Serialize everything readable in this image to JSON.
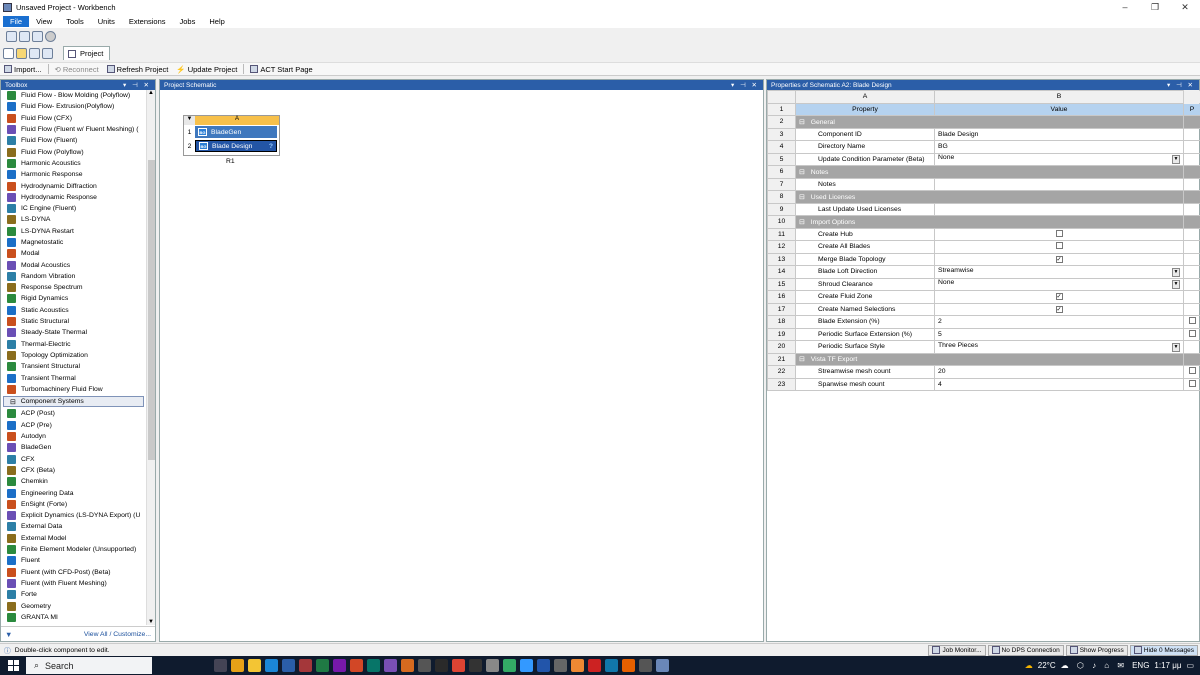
{
  "window": {
    "title": "Unsaved Project - Workbench"
  },
  "menus": [
    "File",
    "View",
    "Tools",
    "Units",
    "Extensions",
    "Jobs",
    "Help"
  ],
  "tab": {
    "label": "Project"
  },
  "commands": {
    "import": "Import...",
    "reconnect": "Reconnect",
    "refresh": "Refresh Project",
    "update": "Update Project",
    "act": "ACT Start Page"
  },
  "toolbox": {
    "title": "Toolbox",
    "analysis_items": [
      "Fluid Flow - Blow Molding (Polyflow)",
      "Fluid Flow- Extrusion(Polyflow)",
      "Fluid Flow (CFX)",
      "Fluid Flow (Fluent w/ Fluent Meshing) (",
      "Fluid Flow (Fluent)",
      "Fluid Flow (Polyflow)",
      "Harmonic Acoustics",
      "Harmonic Response",
      "Hydrodynamic Diffraction",
      "Hydrodynamic Response",
      "IC Engine (Fluent)",
      "LS-DYNA",
      "LS-DYNA Restart",
      "Magnetostatic",
      "Modal",
      "Modal Acoustics",
      "Random Vibration",
      "Response Spectrum",
      "Rigid Dynamics",
      "Static Acoustics",
      "Static Structural",
      "Steady-State Thermal",
      "Thermal-Electric",
      "Topology Optimization",
      "Transient Structural",
      "Transient Thermal",
      "Turbomachinery Fluid Flow"
    ],
    "group_label": "Component Systems",
    "component_items": [
      "ACP (Post)",
      "ACP (Pre)",
      "Autodyn",
      "BladeGen",
      "CFX",
      "CFX (Beta)",
      "Chemkin",
      "Engineering Data",
      "EnSight (Forte)",
      "Explicit Dynamics (LS-DYNA Export) (U",
      "External Data",
      "External Model",
      "Finite Element Modeler (Unsupported)",
      "Fluent",
      "Fluent (with CFD-Post) (Beta)",
      "Fluent (with Fluent Meshing)",
      "Forte",
      "Geometry",
      "GRANTA MI"
    ],
    "footer_link": "View All / Customize..."
  },
  "schematic": {
    "title": "Project Schematic",
    "system": {
      "column": "A",
      "rows": [
        {
          "num": "1",
          "label": "BladeGen"
        },
        {
          "num": "2",
          "label": "Blade Design"
        }
      ],
      "name": "R1"
    }
  },
  "properties": {
    "title": "Properties of Schematic A2: Blade Design",
    "columns": [
      "A",
      "B",
      "D"
    ],
    "header": {
      "property": "Property",
      "value": "Value",
      "p": "P"
    },
    "rows": [
      {
        "n": "2",
        "type": "section",
        "label": "General"
      },
      {
        "n": "3",
        "type": "prop",
        "label": "Component ID",
        "value": "Blade Design",
        "ctl": "none",
        "p": false
      },
      {
        "n": "4",
        "type": "prop",
        "label": "Directory Name",
        "value": "BG",
        "ctl": "none",
        "p": false
      },
      {
        "n": "5",
        "type": "prop",
        "label": "Update Condition Parameter (Beta)",
        "value": "None",
        "ctl": "dropdown",
        "p": false
      },
      {
        "n": "6",
        "type": "section",
        "label": "Notes"
      },
      {
        "n": "7",
        "type": "prop",
        "label": "Notes",
        "value": "",
        "ctl": "none",
        "p": false
      },
      {
        "n": "8",
        "type": "section",
        "label": "Used Licenses"
      },
      {
        "n": "9",
        "type": "prop",
        "label": "Last Update Used Licenses",
        "value": "",
        "ctl": "none",
        "p": false
      },
      {
        "n": "10",
        "type": "section",
        "label": "Import Options"
      },
      {
        "n": "11",
        "type": "prop",
        "label": "Create Hub",
        "value": "",
        "ctl": "checkbox",
        "checked": false,
        "p": false
      },
      {
        "n": "12",
        "type": "prop",
        "label": "Create All Blades",
        "value": "",
        "ctl": "checkbox",
        "checked": false,
        "p": false
      },
      {
        "n": "13",
        "type": "prop",
        "label": "Merge Blade Topology",
        "value": "",
        "ctl": "checkbox",
        "checked": true,
        "p": false
      },
      {
        "n": "14",
        "type": "prop",
        "label": "Blade Loft Direction",
        "value": "Streamwise",
        "ctl": "dropdown",
        "p": false
      },
      {
        "n": "15",
        "type": "prop",
        "label": "Shroud Clearance",
        "value": "None",
        "ctl": "dropdown",
        "p": false
      },
      {
        "n": "16",
        "type": "prop",
        "label": "Create Fluid Zone",
        "value": "",
        "ctl": "checkbox",
        "checked": true,
        "p": false
      },
      {
        "n": "17",
        "type": "prop",
        "label": "Create Named Selections",
        "value": "",
        "ctl": "checkbox",
        "checked": true,
        "p": false
      },
      {
        "n": "18",
        "type": "prop",
        "label": "Blade Extension (%)",
        "value": "2",
        "ctl": "none",
        "p": true
      },
      {
        "n": "19",
        "type": "prop",
        "label": "Periodic Surface Extension (%)",
        "value": "5",
        "ctl": "none",
        "p": true
      },
      {
        "n": "20",
        "type": "prop",
        "label": "Periodic Surface Style",
        "value": "Three Pieces",
        "ctl": "dropdown",
        "p": false
      },
      {
        "n": "21",
        "type": "section",
        "label": "Vista TF Export"
      },
      {
        "n": "22",
        "type": "prop",
        "label": "Streamwise mesh count",
        "value": "20",
        "ctl": "none",
        "p": true
      },
      {
        "n": "23",
        "type": "prop",
        "label": "Spanwise mesh count",
        "value": "4",
        "ctl": "none",
        "p": true
      }
    ]
  },
  "status": {
    "message": "Double-click component to edit.",
    "buttons": [
      "Job Monitor...",
      "No DPS Connection",
      "Show Progress",
      "Hide 0 Messages"
    ]
  },
  "taskbar": {
    "search": "Search",
    "weather": "22°C",
    "lang": "ENG",
    "time": "1:17 μμ"
  }
}
